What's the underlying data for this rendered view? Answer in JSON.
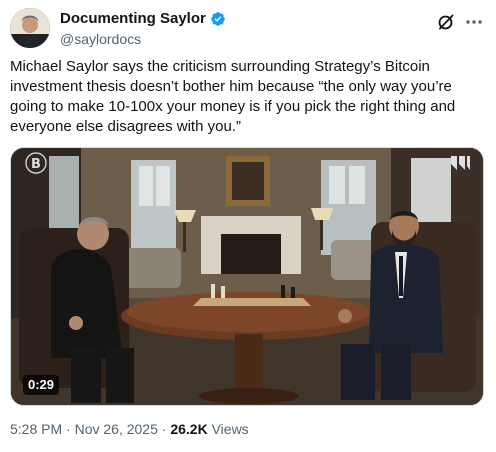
{
  "author": {
    "display_name": "Documenting Saylor",
    "handle": "@saylordocs",
    "avatar_icon": "avatar-portrait",
    "verified_color": "#1d9bf0"
  },
  "actions": {
    "grok_icon": "grok-icon",
    "more_icon": "more-options-icon"
  },
  "tweet": {
    "text": "Michael Saylor says the criticism surrounding Strategy’s Bitcoin investment thesis doesn’t bother him because “the only way you’re going to make 10-100x your money is if you pick the right thing and everyone else disagrees with you.”"
  },
  "media": {
    "duration": "0:29",
    "logo_left_icon": "bitcoin-b-logo-icon",
    "logo_right_icon": "channel-logo-icon"
  },
  "meta": {
    "time": "5:28 PM",
    "separator": " · ",
    "date": "Nov 26, 2025",
    "views_count": "26.2K",
    "views_label": " Views"
  }
}
